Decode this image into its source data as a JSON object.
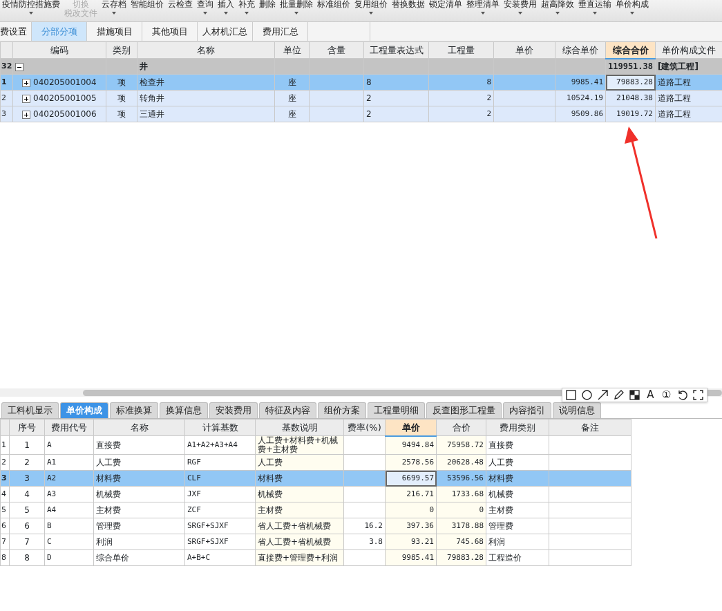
{
  "toolbar": [
    {
      "label": "疫情防控措施费",
      "dropdown": true,
      "disabled": false
    },
    {
      "lines": [
        "切换",
        "税改文件"
      ],
      "dropdown": false,
      "disabled": true
    },
    {
      "label": "云存档",
      "dropdown": true,
      "disabled": false
    },
    {
      "label": "智能组价",
      "dropdown": false,
      "disabled": false
    },
    {
      "label": "云检查",
      "dropdown": false,
      "disabled": false
    },
    {
      "label": "查询",
      "dropdown": true,
      "disabled": false
    },
    {
      "label": "插入",
      "dropdown": true,
      "disabled": false
    },
    {
      "label": "补充",
      "dropdown": true,
      "disabled": false
    },
    {
      "label": "删除",
      "dropdown": false,
      "disabled": false
    },
    {
      "label": "批量删除",
      "dropdown": true,
      "disabled": false
    },
    {
      "label": "标准组价",
      "dropdown": false,
      "disabled": false
    },
    {
      "label": "复用组价",
      "dropdown": true,
      "disabled": false
    },
    {
      "label": "替换数据",
      "dropdown": false,
      "disabled": false
    },
    {
      "label": "锁定清单",
      "dropdown": false,
      "disabled": false
    },
    {
      "label": "整理清单",
      "dropdown": true,
      "disabled": false
    },
    {
      "label": "安装费用",
      "dropdown": true,
      "disabled": false
    },
    {
      "label": "超高降效",
      "dropdown": true,
      "disabled": false
    },
    {
      "label": "垂直运输",
      "dropdown": true,
      "disabled": false
    },
    {
      "label": "单价构成",
      "dropdown": true,
      "disabled": false
    }
  ],
  "tabs": [
    {
      "label": "费设置",
      "selected": false
    },
    {
      "label": "分部分项",
      "selected": true
    },
    {
      "label": "措施项目",
      "selected": false
    },
    {
      "label": "其他项目",
      "selected": false
    },
    {
      "label": "人材机汇总",
      "selected": false
    },
    {
      "label": "费用汇总",
      "selected": false
    }
  ],
  "top_table": {
    "columns": [
      {
        "label": "编码",
        "selected": false
      },
      {
        "label": "类别",
        "selected": false
      },
      {
        "label": "名称",
        "selected": false
      },
      {
        "label": "单位",
        "selected": false
      },
      {
        "label": "含量",
        "selected": false
      },
      {
        "label": "工程量表达式",
        "selected": false
      },
      {
        "label": "工程量",
        "selected": false
      },
      {
        "label": "单价",
        "selected": false
      },
      {
        "label": "综合单价",
        "selected": false
      },
      {
        "label": "综合合价",
        "selected": true
      },
      {
        "label": "单价构成文件",
        "selected": false
      }
    ],
    "rows": [
      {
        "number": "32",
        "expanded": true,
        "children": [
          {
            "number": "1",
            "expanded": false,
            "selected": true,
            "cells": [
              "040205001004",
              "项",
              "检查井",
              "座",
              "",
              "8",
              "8",
              "",
              "9985.41",
              "79883.28",
              "道路工程"
            ]
          },
          {
            "number": "2",
            "expanded": false,
            "selected": false,
            "cells": [
              "040205001005",
              "项",
              "转角井",
              "座",
              "",
              "2",
              "2",
              "",
              "10524.19",
              "21048.38",
              "道路工程"
            ]
          },
          {
            "number": "3",
            "expanded": false,
            "selected": false,
            "cells": [
              "040205001006",
              "项",
              "三通井",
              "座",
              "",
              "2",
              "2",
              "",
              "9509.86",
              "19019.72",
              "道路工程"
            ]
          }
        ],
        "cells": [
          "",
          "",
          "井",
          "",
          "",
          "",
          "",
          "",
          "",
          "119951.38",
          "[建筑工程]"
        ]
      }
    ]
  },
  "bottom_tabs": [
    {
      "label": "工料机显示",
      "selected": false
    },
    {
      "label": "单价构成",
      "selected": true
    },
    {
      "label": "标准换算",
      "selected": false
    },
    {
      "label": "换算信息",
      "selected": false
    },
    {
      "label": "安装费用",
      "selected": false
    },
    {
      "label": "特征及内容",
      "selected": false
    },
    {
      "label": "组价方案",
      "selected": false
    },
    {
      "label": "工程量明细",
      "selected": false
    },
    {
      "label": "反查图形工程量",
      "selected": false
    },
    {
      "label": "内容指引",
      "selected": false
    },
    {
      "label": "说明信息",
      "selected": false
    }
  ],
  "annotation_tools": [
    {
      "kind": "rect"
    },
    {
      "kind": "circle"
    },
    {
      "kind": "arrow"
    },
    {
      "kind": "pencil"
    },
    {
      "kind": "mosaic"
    },
    {
      "kind": "text",
      "glyph": "A"
    },
    {
      "kind": "text",
      "glyph": "①"
    },
    {
      "kind": "undo"
    },
    {
      "kind": "expand"
    }
  ],
  "bottom_table": {
    "columns": [
      {
        "label": "序号",
        "selected": false,
        "tinted": false
      },
      {
        "label": "费用代号",
        "selected": false,
        "tinted": false
      },
      {
        "label": "名称",
        "selected": false,
        "tinted": false
      },
      {
        "label": "计算基数",
        "selected": false,
        "tinted": false
      },
      {
        "label": "基数说明",
        "selected": false,
        "tinted": true
      },
      {
        "label": "费率(%)",
        "selected": false,
        "tinted": false
      },
      {
        "label": "单价",
        "selected": true,
        "tinted": true
      },
      {
        "label": "合价",
        "selected": false,
        "tinted": true
      },
      {
        "label": "费用类别",
        "selected": false,
        "tinted": false
      },
      {
        "label": "备注",
        "selected": false,
        "tinted": false
      }
    ],
    "rows": [
      {
        "number": "1",
        "selected": false,
        "cells": [
          "1",
          "A",
          "直接费",
          "A1+A2+A3+A4",
          "人工费+材料费+机械费+主材费",
          "",
          "9494.84",
          "75958.72",
          "直接费",
          ""
        ]
      },
      {
        "number": "2",
        "selected": false,
        "cells": [
          "2",
          "A1",
          "人工费",
          "RGF",
          "人工费",
          "",
          "2578.56",
          "20628.48",
          "人工费",
          ""
        ]
      },
      {
        "number": "3",
        "selected": true,
        "cells": [
          "3",
          "A2",
          "材料费",
          "CLF",
          "材料费",
          "",
          "6699.57",
          "53596.56",
          "材料费",
          ""
        ]
      },
      {
        "number": "4",
        "selected": false,
        "cells": [
          "4",
          "A3",
          "机械费",
          "JXF",
          "机械费",
          "",
          "216.71",
          "1733.68",
          "机械费",
          ""
        ]
      },
      {
        "number": "5",
        "selected": false,
        "cells": [
          "5",
          "A4",
          "主材费",
          "ZCF",
          "主材费",
          "",
          "0",
          "0",
          "主材费",
          ""
        ]
      },
      {
        "number": "6",
        "selected": false,
        "cells": [
          "6",
          "B",
          "管理费",
          "SRGF+SJXF",
          "省人工费+省机械费",
          "16.2",
          "397.36",
          "3178.88",
          "管理费",
          ""
        ]
      },
      {
        "number": "7",
        "selected": false,
        "cells": [
          "7",
          "C",
          "利润",
          "SRGF+SJXF",
          "省人工费+省机械费",
          "3.8",
          "93.21",
          "745.68",
          "利润",
          ""
        ]
      },
      {
        "number": "8",
        "selected": false,
        "cells": [
          "8",
          "D",
          "综合单价",
          "A+B+C",
          "直接费+管理费+利润",
          "",
          "9985.41",
          "79883.28",
          "工程造价",
          ""
        ]
      }
    ]
  }
}
